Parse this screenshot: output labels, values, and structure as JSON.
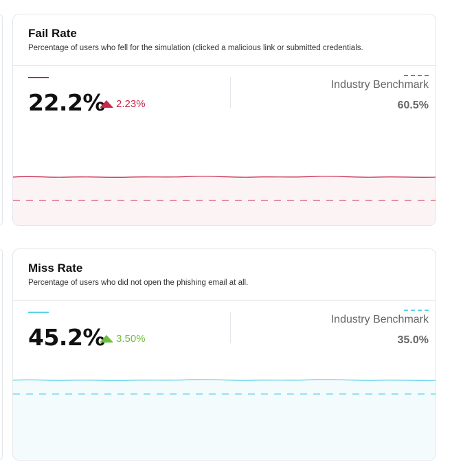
{
  "cards": [
    {
      "title": "Fail Rate",
      "subtitle": "Percentage of users who fell for the simulation (clicked a malicious link or submitted credentials.",
      "value": "22.2%",
      "trend": "2.23%",
      "trend_direction": "up",
      "trend_color": "#c8284a",
      "series_color": "#c8284a",
      "benchmark_label": "Industry Benchmark",
      "benchmark_value": "60.5%",
      "benchmark_color": "#d35a72",
      "fill_color": "#fcf3f5"
    },
    {
      "title": "Miss Rate",
      "subtitle": "Percentage of users who did not open the phishing email at all.",
      "value": "45.2%",
      "trend": "3.50%",
      "trend_direction": "up",
      "trend_color": "#6abf3b",
      "series_color": "#5bd3e6",
      "benchmark_label": "Industry Benchmark",
      "benchmark_value": "35.0%",
      "benchmark_color": "#5bd3e6",
      "fill_color": "#f3fbfd"
    }
  ]
}
